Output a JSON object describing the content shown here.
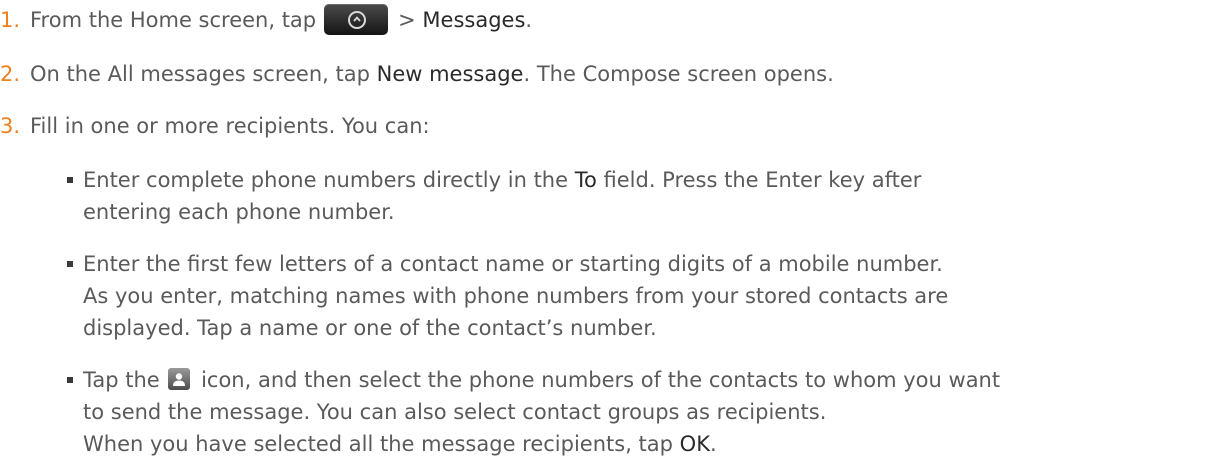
{
  "steps": [
    {
      "number": "1.",
      "pre": "From the Home screen, tap",
      "mid": "> ",
      "keyword": "Messages",
      "post": "."
    },
    {
      "number": "2.",
      "pre": "On the All messages screen, tap ",
      "keyword": "New message",
      "post": ". The Compose screen opens."
    },
    {
      "number": "3.",
      "text": "Fill in one or more recipients. You can:"
    }
  ],
  "bullets": [
    {
      "line1_pre": "Enter complete phone numbers directly in the ",
      "line1_keyword": "To",
      "line1_post": " field. Press the Enter key after",
      "line2": "entering each phone number."
    },
    {
      "line1": "Enter the first few letters of a contact name or starting digits of a mobile number.",
      "line2": "As you enter, matching names with phone numbers from your stored contacts are",
      "line3": "displayed. Tap a name or one of the contact’s number."
    },
    {
      "line1_pre": "Tap the",
      "line1_post": "icon, and then select the phone numbers of the contacts to whom you want",
      "line2": "to send the message. You can also select contact groups as recipients.",
      "line3_pre": "When you have selected all the message recipients, tap ",
      "line3_keyword": "OK",
      "line3_post": "."
    }
  ],
  "icons": {
    "apps_button": "all-apps-icon",
    "contacts": "contact-person-icon"
  },
  "colors": {
    "step_number": "#f07f1d",
    "body_text": "#5a5a5a",
    "keyword_text": "#2a2a2a"
  }
}
